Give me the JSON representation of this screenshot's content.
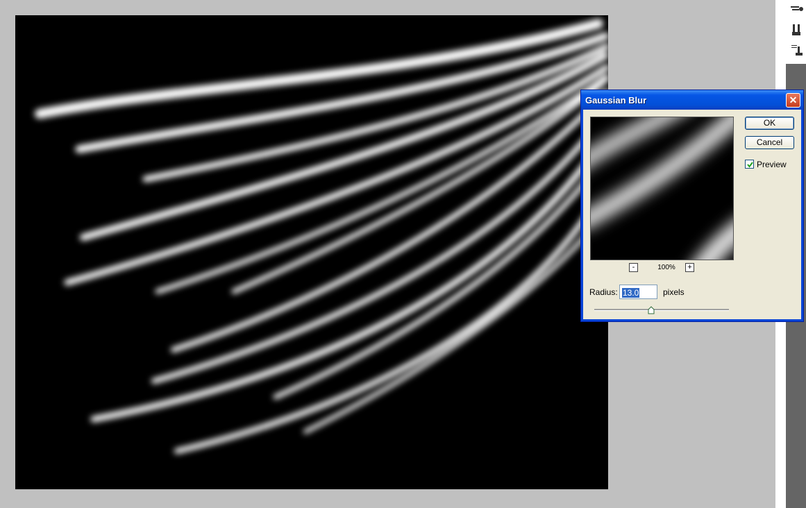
{
  "dialog": {
    "title": "Gaussian Blur",
    "ok_label": "OK",
    "cancel_label": "Cancel",
    "preview_label": "Preview",
    "preview_checked": true,
    "zoom_minus": "-",
    "zoom_plus": "+",
    "zoom_value": "100%",
    "radius_label": "Radius:",
    "radius_value": "13.0",
    "radius_unit": "pixels"
  },
  "toolbar": {
    "icons": [
      "brush-presets-icon",
      "clone-source-icon",
      "tool-presets-icon"
    ]
  },
  "colors": {
    "canvas_background": "#000000",
    "workspace": "#c0c0c0",
    "titlebar": "#0556e0",
    "dialog_face": "#ece9d8"
  }
}
